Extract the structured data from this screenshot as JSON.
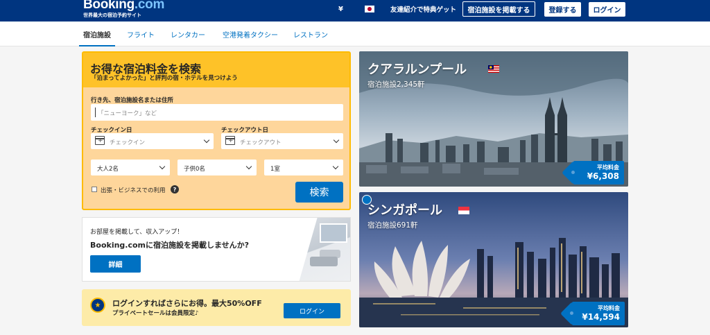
{
  "header": {
    "logo_main": "Booking",
    "logo_dot": ".com",
    "tagline": "世界最大の宿泊予約サイト",
    "currency": "¥",
    "referral": "友達紹介で特典ゲット",
    "list_property": "宿泊施設を掲載する",
    "register": "登録する",
    "login": "ログイン"
  },
  "nav": {
    "items": [
      {
        "label": "宿泊施設"
      },
      {
        "label": "フライト"
      },
      {
        "label": "レンタカー"
      },
      {
        "label": "空港発着タクシー"
      },
      {
        "label": "レストラン"
      }
    ]
  },
  "search": {
    "title": "お得な宿泊料金を検索",
    "subtitle": "「泊まってよかった」と評判の宿・ホテルを見つけよう",
    "destination_label": "行き先、宿泊施設名または住所",
    "destination_placeholder": "「ニューヨーク」など",
    "checkin_label": "チェックイン日",
    "checkin_placeholder": "チェックイン",
    "checkout_label": "チェックアウト日",
    "checkout_placeholder": "チェックアウト",
    "adults": "大人2名",
    "children": "子供0名",
    "rooms": "1室",
    "business_label": "出張・ビジネスでの利用",
    "help": "?",
    "search_button": "検索"
  },
  "promo": {
    "line1": "お部屋を掲載して、収入アップ！",
    "line2": "Booking.comに宿泊施設を掲載しませんか?",
    "button": "詳細"
  },
  "genius": {
    "title": "ログインすればさらにお得。最大50%OFF",
    "subtitle": "プライベートセールは会員限定♪",
    "button": "ログイン"
  },
  "destinations": [
    {
      "city": "クアラルンプール",
      "count": "宿泊施設2,345軒",
      "price_label": "平均料金",
      "price": "¥6,308"
    },
    {
      "city": "シンガポール",
      "count": "宿泊施設691軒",
      "price_label": "平均料金",
      "price": "¥14,594"
    }
  ]
}
